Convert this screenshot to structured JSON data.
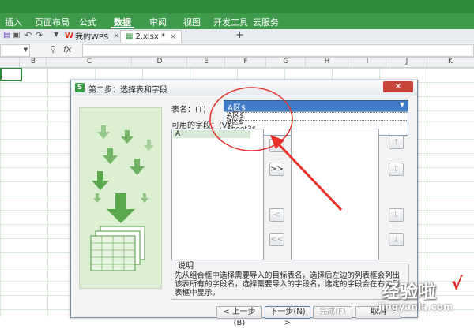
{
  "menu": {
    "items": [
      "插入",
      "页面布局",
      "公式",
      "数据",
      "审阅",
      "视图",
      "开发工具",
      "云服务"
    ],
    "active": "数据"
  },
  "tabs": {
    "wps_home": "我的WPS",
    "file": "2.xlsx *",
    "new_tab": "+"
  },
  "formula": {
    "fx": "fx"
  },
  "columns": [
    "B",
    "C",
    "D",
    "E",
    "F",
    "G",
    "H",
    "I",
    "J",
    "K"
  ],
  "dialog": {
    "title": "第二步：选择表和字段",
    "table_label": "表名：(T)",
    "table_value": "A区$",
    "table_options": [
      "A区$",
      "B区$",
      "Sheet3$"
    ],
    "available_label": "可用的字段：(V)",
    "available_fields": [
      "A"
    ],
    "btn_add_all": ">>",
    "btn_add": ">",
    "btn_remove": "<",
    "btn_remove_all": "<<",
    "desc_title": "说明",
    "desc_text": "先从组合框中选择需要导入的目标表名，选择后左边的列表框会列出该表所有的字段名，选择需要导入的字段名，选定的字段会在右边列表框中显示。",
    "buttons": {
      "prev": "< 上一步(B)",
      "next": "下一步(N) >",
      "finish": "完成(F)",
      "cancel": "取消"
    }
  },
  "watermark": {
    "text": "经验啦",
    "check": "√",
    "url": "jingyanla.com"
  },
  "colors": {
    "ribbon": "#3f9a4c",
    "accent": "#2f8a3c",
    "arrow": "#e8302a",
    "select": "#3f7cc5"
  }
}
